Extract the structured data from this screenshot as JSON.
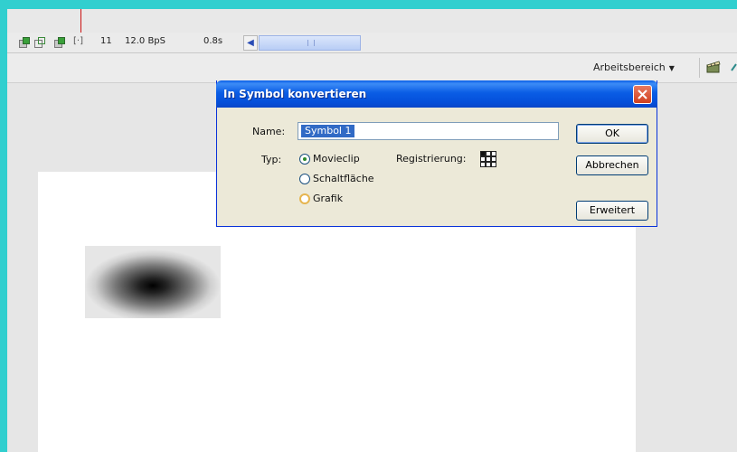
{
  "timeline": {
    "frame_number": "11",
    "frame_rate": "12.0 BpS",
    "elapsed_time": "0.8s"
  },
  "workspace": {
    "label": "Arbeitsbereich"
  },
  "dialog": {
    "title": "In Symbol konvertieren",
    "name_label": "Name:",
    "name_value": "Symbol 1",
    "type_label": "Typ:",
    "type_options": [
      "Movieclip",
      "Schaltfläche",
      "Grafik"
    ],
    "selected_type": "Movieclip",
    "registration_label": "Registrierung:",
    "buttons": {
      "ok": "OK",
      "cancel": "Abbrechen",
      "advanced": "Erweitert"
    }
  },
  "colors": {
    "accent_blue": "#0a5de5",
    "stage_white": "#ffffff",
    "dialog_bg": "#ece9d8",
    "close_red": "#d0401f",
    "selection_blue": "#316ac5"
  },
  "icons": [
    "onion-skin-icon",
    "onion-outline-icon",
    "edit-multiple-frames-icon",
    "onion-markers-icon",
    "scroll-left-icon",
    "clapperboard-icon",
    "close-icon",
    "registration-grid-icon"
  ]
}
